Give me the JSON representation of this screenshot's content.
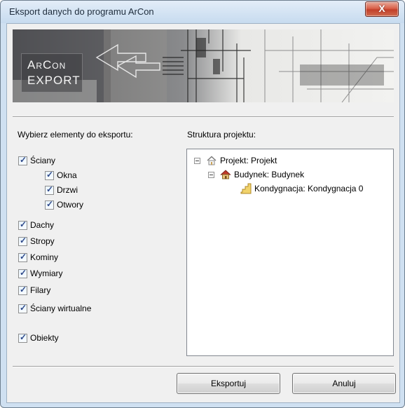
{
  "window": {
    "title": "Eksport danych do programu ArCon",
    "close_symbol": "X"
  },
  "banner": {
    "logo_line1": "ArCon",
    "logo_line2": "EXPORT"
  },
  "left": {
    "heading": "Wybierz elementy do eksportu:",
    "items": [
      {
        "label": "Ściany",
        "checked": true
      },
      {
        "label": "Okna",
        "checked": true
      },
      {
        "label": "Drzwi",
        "checked": true
      },
      {
        "label": "Otwory",
        "checked": true
      },
      {
        "label": "Dachy",
        "checked": true
      },
      {
        "label": "Stropy",
        "checked": true
      },
      {
        "label": "Kominy",
        "checked": true
      },
      {
        "label": "Wymiary",
        "checked": true
      },
      {
        "label": "Filary",
        "checked": true
      },
      {
        "label": "Ściany wirtualne",
        "checked": true
      },
      {
        "label": "Obiekty",
        "checked": true
      }
    ],
    "check_symbol": "✓"
  },
  "right": {
    "heading": "Struktura projektu:",
    "tree": [
      {
        "label": "Projekt: Projekt",
        "icon": "project-house-icon",
        "expander": "minus"
      },
      {
        "label": "Budynek: Budynek",
        "icon": "building-house-icon",
        "expander": "minus"
      },
      {
        "label": "Kondygnacja: Kondygnacja 0",
        "icon": "floor-stairs-icon",
        "expander": "none"
      }
    ]
  },
  "buttons": {
    "export": "Eksportuj",
    "cancel": "Anuluj"
  }
}
